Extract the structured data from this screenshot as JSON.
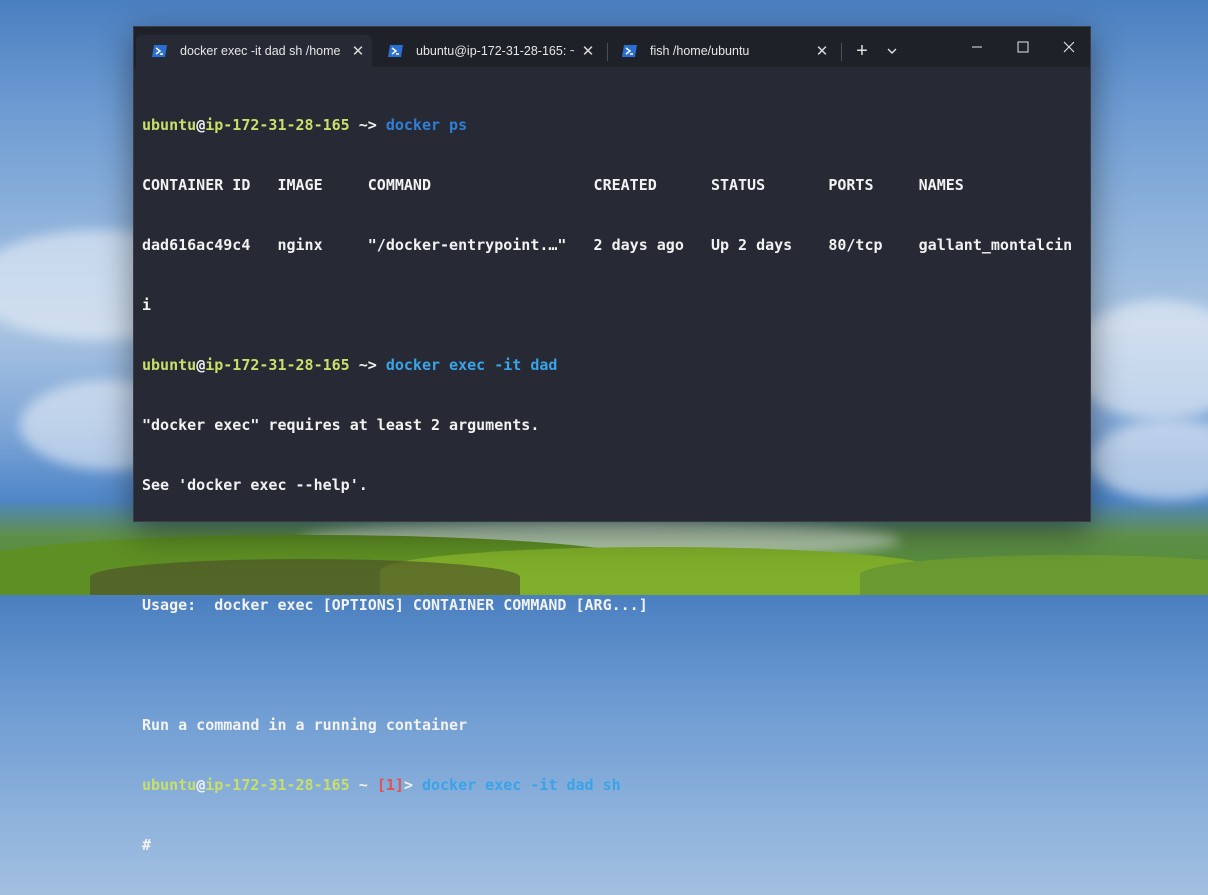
{
  "tabs": [
    {
      "title": "docker exec -it dad sh /home",
      "close": "✕",
      "active": true
    },
    {
      "title": "ubuntu@ip-172-31-28-165: ~",
      "close": "✕",
      "active": false
    },
    {
      "title": "fish /home/ubuntu",
      "close": "✕",
      "active": false
    }
  ],
  "titlebar": {
    "new_tab": "+"
  },
  "terminal": {
    "user": "ubuntu",
    "at": "@",
    "host": "ip-172-31-28-165",
    "prompt_tilde": " ~>",
    "cmd1": "docker ps",
    "ps_header": "CONTAINER ID   IMAGE     COMMAND                  CREATED      STATUS       PORTS     NAMES",
    "ps_row": "dad616ac49c4   nginx     \"/docker-entrypoint.…\"   2 days ago   Up 2 days    80/tcp    gallant_montalcin",
    "ps_wrap": "i",
    "cmd2": "docker exec -it dad",
    "err1": "\"docker exec\" requires at least 2 arguments.",
    "err2": "See 'docker exec --help'.",
    "usage": "Usage:  docker exec [OPTIONS] CONTAINER COMMAND [ARG...]",
    "desc": "Run a command in a running container",
    "prompt3_tilde": " ~ ",
    "status_code": "[1]",
    "prompt3_arrow": "> ",
    "cmd3": "docker exec -it dad sh",
    "shell_prompt": "#"
  },
  "colors": {
    "user": "#c6e06a",
    "command": "#2f7fd6",
    "error": "#e05252",
    "background": "#272a34"
  }
}
